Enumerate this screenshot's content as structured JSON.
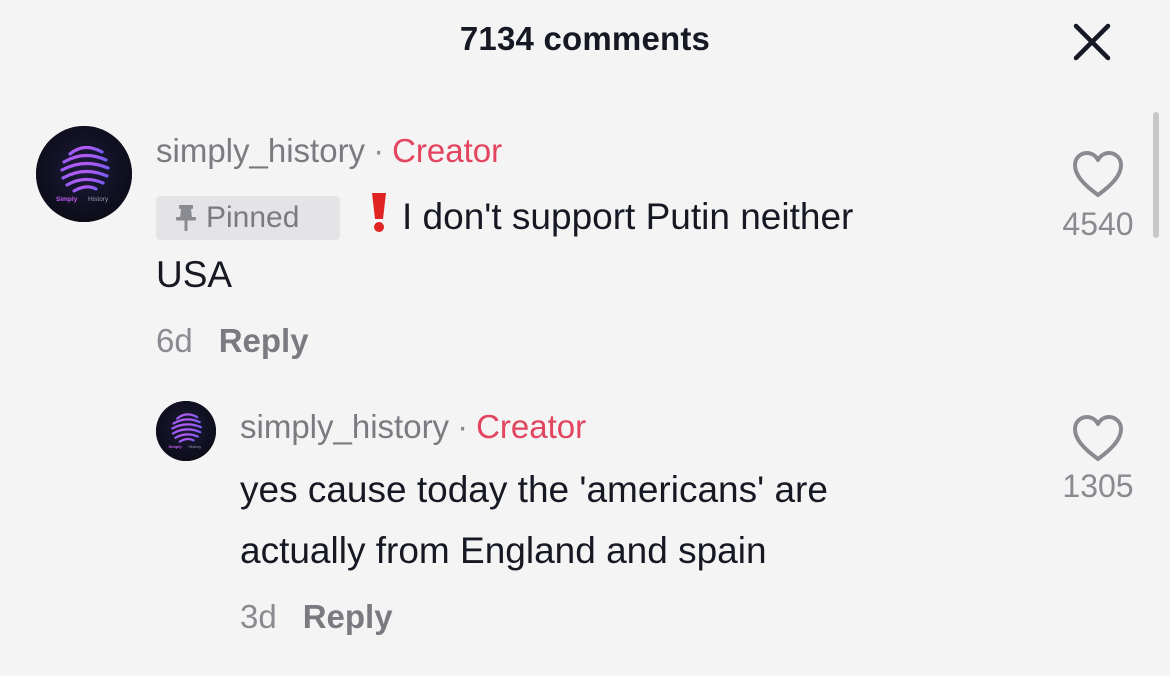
{
  "header": {
    "title": "7134 comments",
    "close_icon": "close-icon"
  },
  "avatar": {
    "label_a": "Simply",
    "label_b": "History"
  },
  "comments": [
    {
      "username": "simply_history",
      "separator": "·",
      "role": "Creator",
      "pinned_label": "Pinned",
      "text_line1": "I don't support Putin neither",
      "text_line2": "USA",
      "time": "6d",
      "reply_label": "Reply",
      "likes": "4540"
    },
    {
      "username": "simply_history",
      "separator": "·",
      "role": "Creator",
      "text_line1": "yes cause today the 'americans' are",
      "text_line2": "actually from England and spain",
      "time": "3d",
      "reply_label": "Reply",
      "likes": "1305"
    }
  ],
  "colors": {
    "accent": "#e3445f",
    "background": "#f4f4f4",
    "secondary_text": "#7a7b80"
  }
}
